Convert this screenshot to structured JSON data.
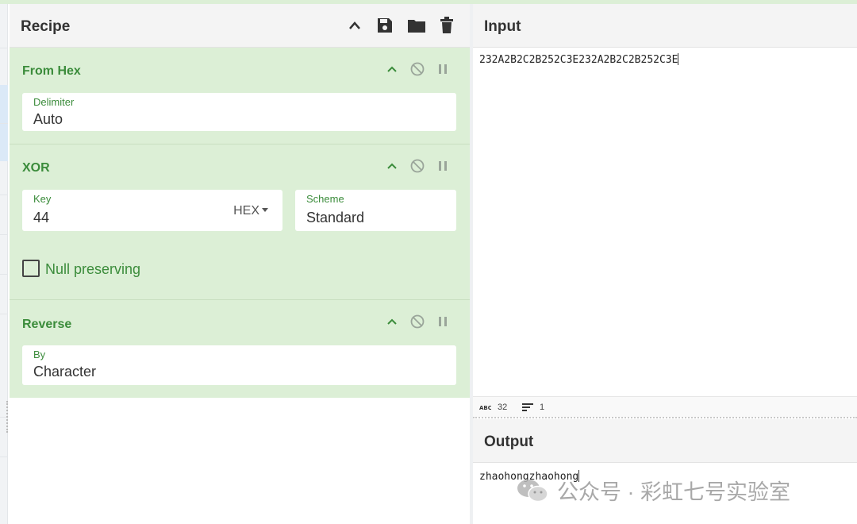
{
  "recipe": {
    "title": "Recipe",
    "operations": [
      {
        "name": "From Hex",
        "fields": [
          {
            "label": "Delimiter",
            "value": "Auto"
          }
        ]
      },
      {
        "name": "XOR",
        "fields": [
          {
            "label": "Key",
            "value": "44",
            "format": "HEX"
          },
          {
            "label": "Scheme",
            "value": "Standard"
          }
        ],
        "checkbox": {
          "label": "Null preserving",
          "checked": false
        }
      },
      {
        "name": "Reverse",
        "fields": [
          {
            "label": "By",
            "value": "Character"
          }
        ]
      }
    ]
  },
  "input": {
    "title": "Input",
    "text": "232A2B2C2B252C3E232A2B2C2B252C3E",
    "status": {
      "length": "32",
      "lines": "1",
      "length_icon": "abc-icon",
      "lines_icon": "lines-icon"
    }
  },
  "output": {
    "title": "Output",
    "text": "zhaohongzhaohong"
  },
  "watermark": {
    "text": "公众号 · 彩虹七号实验室",
    "icon": "wechat-icon"
  },
  "colors": {
    "op_bg": "#dcefd6",
    "op_title": "#3b8c3b",
    "header_bg": "#f4f4f4"
  }
}
